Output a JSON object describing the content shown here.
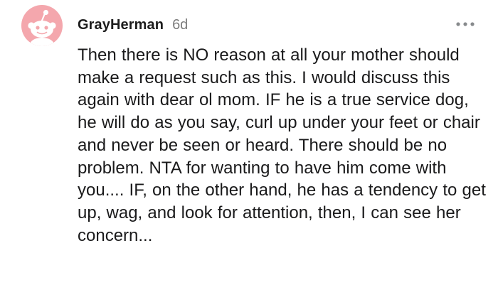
{
  "comment": {
    "author": "GrayHerman",
    "age": "6d",
    "avatar_icon": "reddit-snoo-avatar-icon",
    "more_icon": "more-options-dots-icon",
    "body": "Then there is NO reason at all your mother should make a request such as this. I would discuss this again with dear ol mom. IF he is a true service dog, he will do as you say, curl up under your feet or chair and never be seen or heard. There should be no problem. NTA for wanting to have him come with you.... IF, on the other hand, he has a tendency to get up, wag, and look for attention, then, I can see her concern..."
  },
  "colors": {
    "avatar_bg": "#f4a7ad",
    "avatar_figure": "#ffffff",
    "author_text": "#1c1c1c",
    "meta_text": "#7c7c7c",
    "body_text": "#1a1a1b",
    "icon_gray": "#878a8c"
  }
}
